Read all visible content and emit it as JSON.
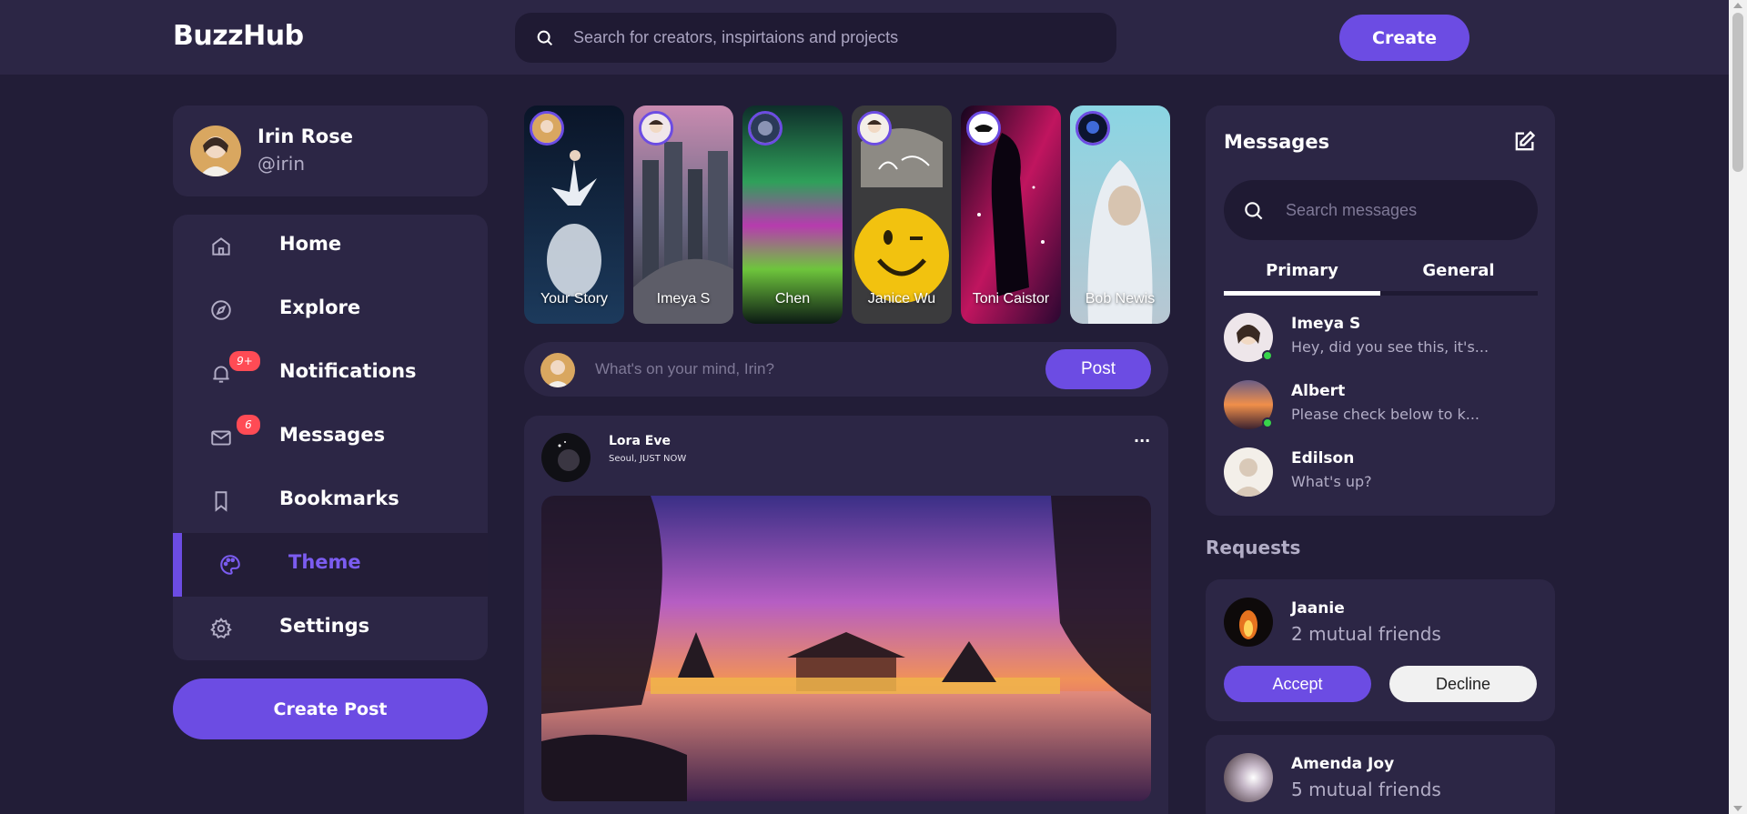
{
  "app": {
    "logo": "BuzzHub",
    "accent": "#6c4ce3"
  },
  "header": {
    "search_placeholder": "Search for creators, inspirtaions and projects",
    "create_label": "Create"
  },
  "profile": {
    "name": "Irin Rose",
    "handle": "@irin"
  },
  "sidebar": {
    "items": [
      {
        "label": "Home",
        "icon": "home-icon"
      },
      {
        "label": "Explore",
        "icon": "compass-icon"
      },
      {
        "label": "Notifications",
        "icon": "bell-icon",
        "badge": "9+"
      },
      {
        "label": "Messages",
        "icon": "mail-icon",
        "badge": "6"
      },
      {
        "label": "Bookmarks",
        "icon": "bookmark-icon"
      },
      {
        "label": "Theme",
        "icon": "palette-icon",
        "active": true
      },
      {
        "label": "Settings",
        "icon": "gear-icon"
      }
    ],
    "create_post_label": "Create Post"
  },
  "stories": [
    {
      "name": "Your Story"
    },
    {
      "name": "Imeya S"
    },
    {
      "name": "Chen"
    },
    {
      "name": "Janice Wu"
    },
    {
      "name": "Toni Caistor"
    },
    {
      "name": "Bob Newis"
    }
  ],
  "composer": {
    "placeholder": "What's on your mind, Irin?",
    "post_label": "Post"
  },
  "feed": [
    {
      "author": "Lora Eve",
      "meta": "Seoul, JUST NOW",
      "more": "..."
    }
  ],
  "messages": {
    "title": "Messages",
    "search_placeholder": "Search messages",
    "tabs": [
      "Primary",
      "General"
    ],
    "items": [
      {
        "name": "Imeya S",
        "preview": "Hey, did you see this, it's...",
        "online": true
      },
      {
        "name": "Albert",
        "preview": "Please check below to k...",
        "online": true
      },
      {
        "name": "Edilson",
        "preview": "What's up?",
        "online": false
      }
    ]
  },
  "requests": {
    "title": "Requests",
    "items": [
      {
        "name": "Jaanie",
        "mutual": "2 mutual friends",
        "accept": "Accept",
        "decline": "Decline"
      },
      {
        "name": "Amenda Joy",
        "mutual": "5 mutual friends"
      }
    ]
  }
}
